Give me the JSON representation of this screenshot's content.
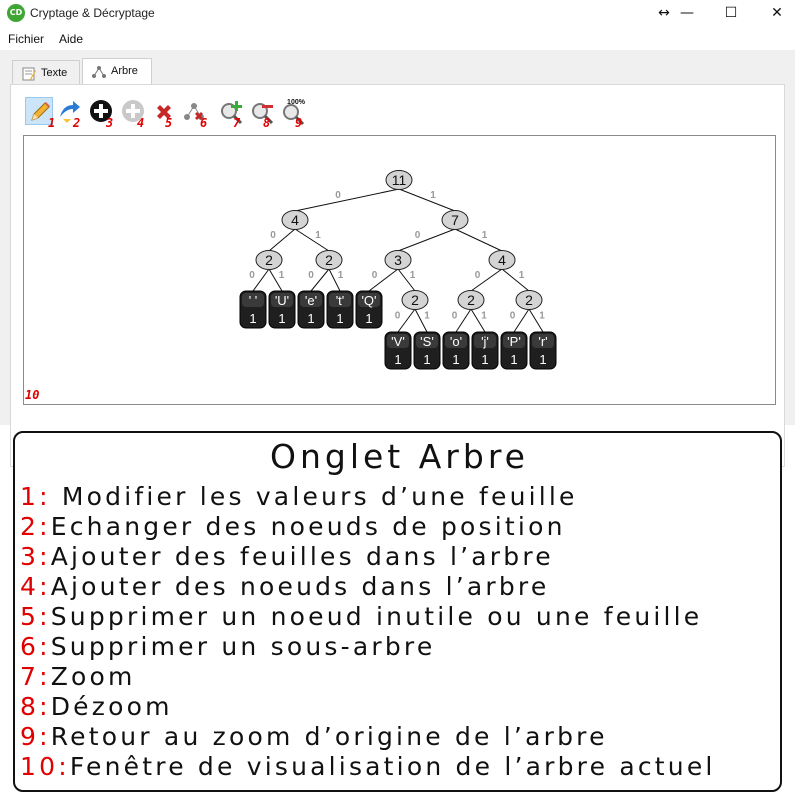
{
  "window": {
    "title": "Cryptage & Décryptage",
    "app_icon_text": "CD",
    "controls": {
      "resize": "↔",
      "minimize": "—",
      "maximize": "☐",
      "close": "✕"
    }
  },
  "menu": {
    "items": [
      "Fichier",
      "Aide"
    ]
  },
  "tabs": [
    {
      "label": "Texte",
      "active": false
    },
    {
      "label": "Arbre",
      "active": true
    }
  ],
  "toolbar": {
    "tools": [
      {
        "name": "pencil-icon",
        "num": "1"
      },
      {
        "name": "swap-arrow-icon",
        "num": "2"
      },
      {
        "name": "add-leaf-icon",
        "num": "3"
      },
      {
        "name": "add-node-icon",
        "num": "4"
      },
      {
        "name": "delete-icon",
        "num": "5"
      },
      {
        "name": "delete-subtree-icon",
        "num": "6"
      },
      {
        "name": "zoom-in-icon",
        "num": "7"
      },
      {
        "name": "zoom-out-icon",
        "num": "8"
      },
      {
        "name": "zoom-reset-icon",
        "num": "9",
        "badge": "100%"
      }
    ]
  },
  "view": {
    "num": "10",
    "tree": {
      "internal": [
        "11",
        "4",
        "7",
        "2",
        "2",
        "3",
        "4",
        "2",
        "2",
        "2"
      ],
      "leaves": [
        {
          "char": "' '",
          "count": "1"
        },
        {
          "char": "'U'",
          "count": "1"
        },
        {
          "char": "'e'",
          "count": "1"
        },
        {
          "char": "'t'",
          "count": "1"
        },
        {
          "char": "'Q'",
          "count": "1"
        },
        {
          "char": "'V'",
          "count": "1"
        },
        {
          "char": "'S'",
          "count": "1"
        },
        {
          "char": "'o'",
          "count": "1"
        },
        {
          "char": "'j'",
          "count": "1"
        },
        {
          "char": "'P'",
          "count": "1"
        },
        {
          "char": "'r'",
          "count": "1"
        }
      ],
      "bit_left": "0",
      "bit_right": "1"
    }
  },
  "legend": {
    "title": "Onglet Arbre",
    "items": [
      {
        "num": "1:",
        "text": " Modifier les valeurs d’une feuille"
      },
      {
        "num": "2:",
        "text": "Echanger des noeuds de position"
      },
      {
        "num": "3:",
        "text": "Ajouter des feuilles dans l’arbre"
      },
      {
        "num": "4:",
        "text": "Ajouter des noeuds dans l’arbre"
      },
      {
        "num": "5:",
        "text": "Supprimer un noeud inutile ou une feuille"
      },
      {
        "num": "6:",
        "text": "Supprimer un sous-arbre"
      },
      {
        "num": "7:",
        "text": "Zoom"
      },
      {
        "num": "8:",
        "text": "Dézoom"
      },
      {
        "num": "9:",
        "text": "Retour au zoom d’origine de l’arbre"
      },
      {
        "num": "10:",
        "text": "Fenêtre de visualisation de l’arbre actuel"
      }
    ]
  }
}
